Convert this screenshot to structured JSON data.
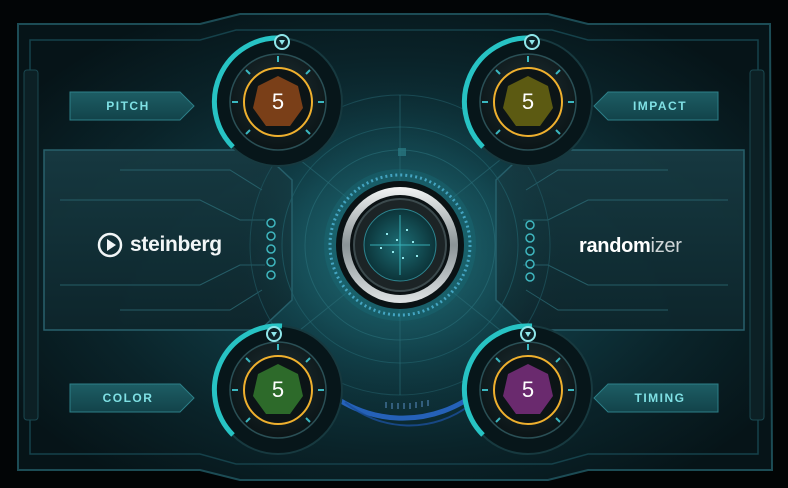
{
  "plugin": {
    "brand_left": "steinberg",
    "brand_right_bold": "random",
    "brand_right_light": "izer"
  },
  "knobs": {
    "pitch": {
      "label": "PITCH",
      "value": "5",
      "color": "#7a3f18"
    },
    "impact": {
      "label": "IMPACT",
      "value": "5",
      "color": "#5c5a12"
    },
    "color": {
      "label": "COLOR",
      "value": "5",
      "color": "#2d6a2a"
    },
    "timing": {
      "label": "TIMING",
      "value": "5",
      "color": "#6a2a6e"
    }
  },
  "theme": {
    "accent": "#28c8c8",
    "background": "#08161b",
    "panel": "#0e2a31"
  },
  "icons": {
    "steinberg_logo": "play-circle-icon",
    "knob_marker": "pin-marker-icon",
    "randomize_button": "ring-button-icon"
  }
}
